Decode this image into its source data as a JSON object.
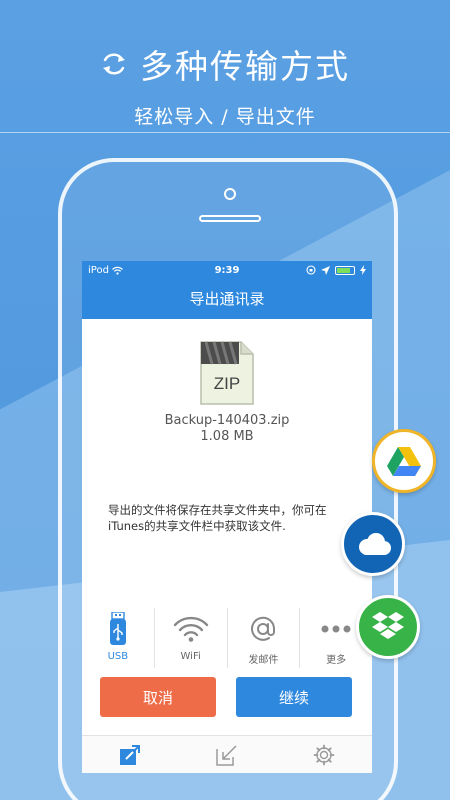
{
  "header": {
    "title": "多种传输方式",
    "subtitle": "轻松导入 / 导出文件"
  },
  "status_bar": {
    "carrier": "iPod",
    "time": "9:39",
    "battery_level": 0.8
  },
  "navbar": {
    "title": "导出通讯录"
  },
  "file": {
    "icon_text": "ZIP",
    "name": "Backup-140403.zip",
    "size": "1.08 MB"
  },
  "hint": "导出的文件将保存在共享文件夹中，你可在iTunes的共享文件栏中获取该文件.",
  "methods": [
    {
      "label": "USB",
      "icon": "usb-icon",
      "selected": true
    },
    {
      "label": "WiFi",
      "icon": "wifi-icon",
      "selected": false
    },
    {
      "label": "发邮件",
      "icon": "at-icon",
      "selected": false
    },
    {
      "label": "更多",
      "icon": "more-icon",
      "selected": false
    }
  ],
  "buttons": {
    "cancel": "取消",
    "continue": "继续"
  },
  "tabs": [
    {
      "icon": "export-icon",
      "active": true
    },
    {
      "icon": "import-icon",
      "active": false
    },
    {
      "icon": "settings-gear-icon",
      "active": false
    }
  ],
  "cloud_services": [
    {
      "icon": "google-drive-icon"
    },
    {
      "icon": "onedrive-icon"
    },
    {
      "icon": "dropbox-icon"
    }
  ],
  "colors": {
    "primary": "#2e89de",
    "cancel": "#ef6c48",
    "background": "#4f97dc",
    "drive_ring": "#f0b429",
    "onedrive": "#1265b5",
    "dropbox": "#38b348"
  }
}
